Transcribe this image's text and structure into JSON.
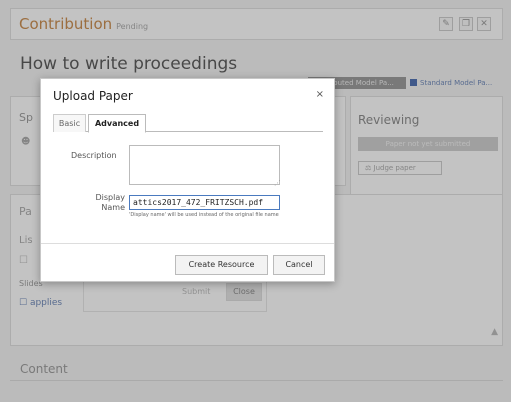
{
  "background": {
    "contribution_title": "Contribution",
    "contribution_subtitle": "Pending",
    "toolbar_icons": [
      "pencil-icon",
      "copy-icon",
      "delete-icon"
    ],
    "page_heading": "How to write proceedings",
    "tag_contributed": "Contributed Model Pa...",
    "tag_standard": "Standard Model Pa...",
    "speakers_label": "Sp",
    "files_label": "Pa",
    "list_label": "Lis",
    "slides_label": "Slides",
    "applies_link": "applies",
    "reviewing_label": "Reviewing",
    "reviewing_button": "Paper not yet submitted",
    "judge_button": "Judge paper",
    "ghost_submit": "Submit",
    "ghost_close": "Close",
    "content_heading": "Content"
  },
  "modal": {
    "title": "Upload Paper",
    "close_label": "×",
    "tabs": [
      "Basic",
      "Advanced"
    ],
    "active_tab": "Advanced",
    "description_label": "Description",
    "description_value": "",
    "display_name_label": "Display Name",
    "display_name_value": "attics2017_472_FRITZSCH.pdf",
    "display_name_hint": "'Display name' will be used instead of the original file name",
    "create_label": "Create Resource",
    "cancel_label": "Cancel"
  },
  "colors": {
    "accent_orange": "#c98a4a",
    "link_blue": "#4a6cb0",
    "input_focus": "#4a7abf"
  }
}
